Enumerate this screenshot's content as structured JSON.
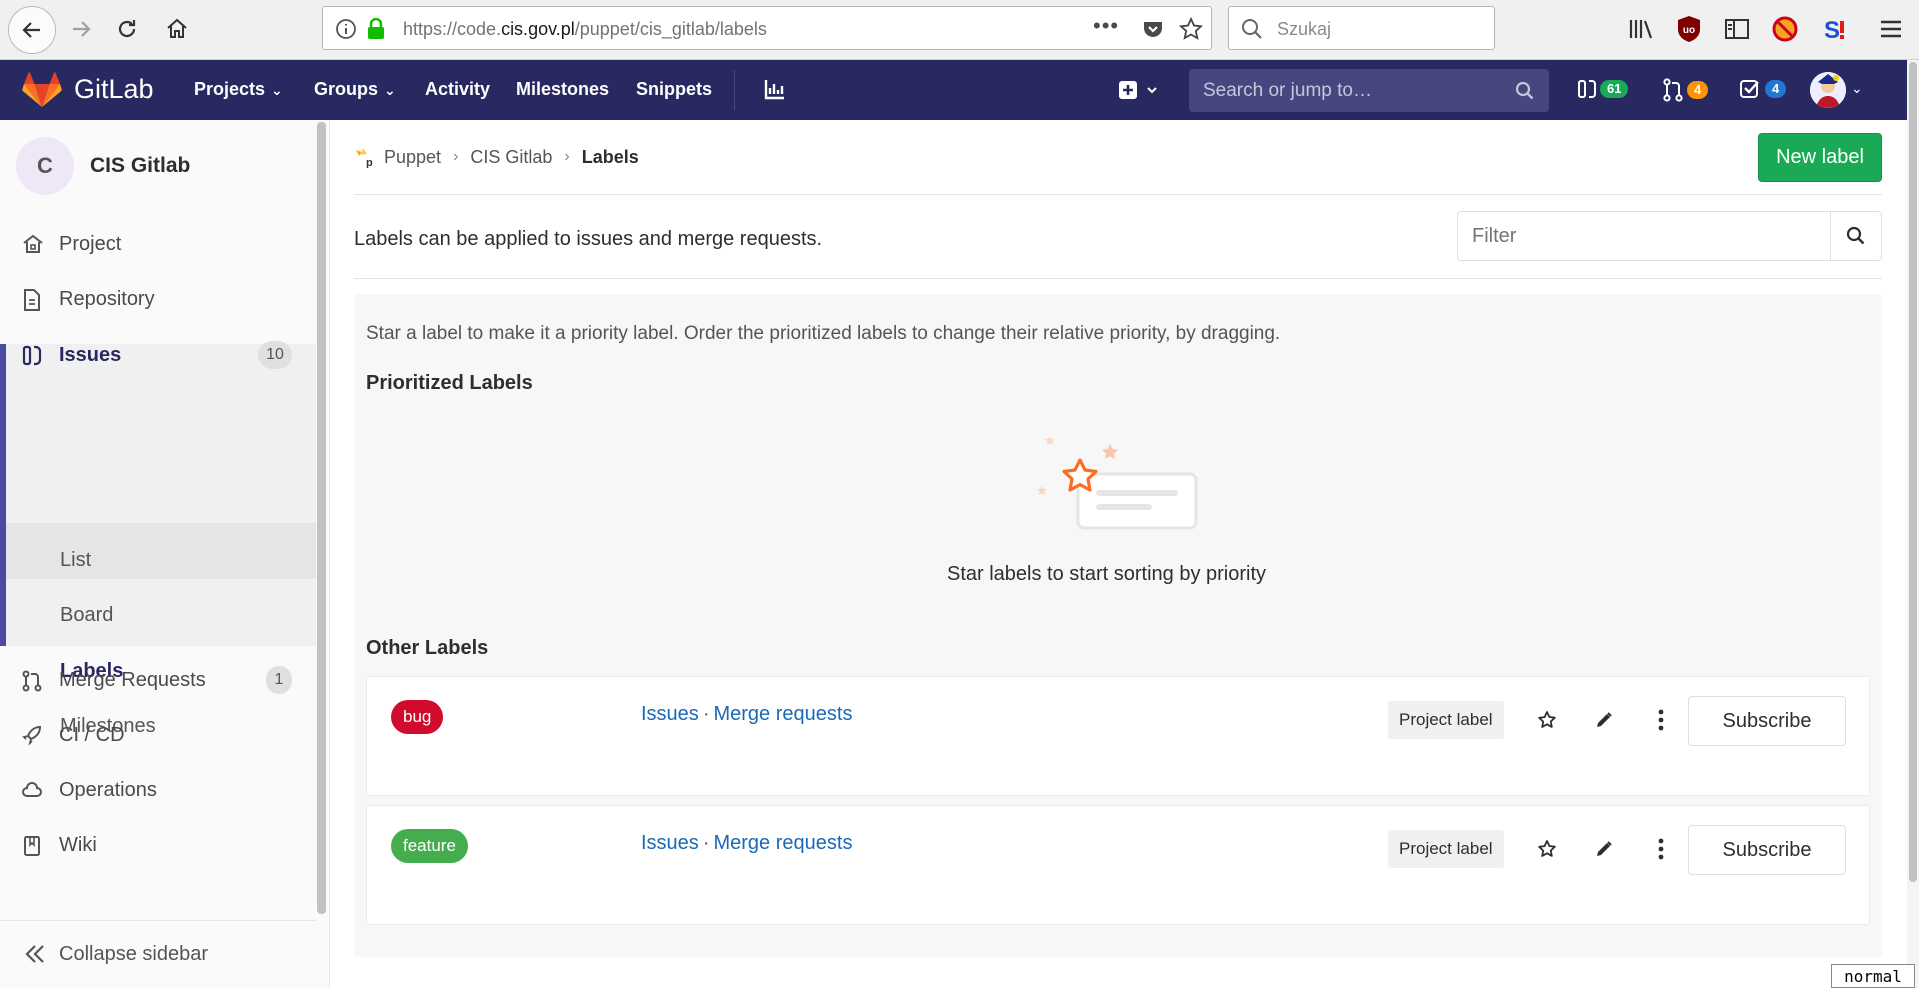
{
  "browser": {
    "url_prefix": "https://code.",
    "url_host": "cis.gov.pl",
    "url_path": "/puppet/cis_gitlab/labels",
    "search_placeholder": "Szukaj"
  },
  "header": {
    "brand": "GitLab",
    "nav": [
      {
        "label": "Projects"
      },
      {
        "label": "Groups"
      },
      {
        "label": "Activity"
      },
      {
        "label": "Milestones"
      },
      {
        "label": "Snippets"
      }
    ],
    "search_placeholder": "Search or jump to…",
    "issues_count": "61",
    "mr_count": "4",
    "todos_count": "4",
    "colors": {
      "bg": "#292961",
      "issues_badge": "#1aaa55",
      "mr_badge": "#fc9403",
      "todos_badge": "#1f78d1"
    }
  },
  "sidebar": {
    "project_initial": "C",
    "project_name": "CIS Gitlab",
    "items": [
      {
        "label": "Project"
      },
      {
        "label": "Repository"
      },
      {
        "label": "Issues",
        "count": "10"
      },
      {
        "label": "Merge Requests",
        "count": "1"
      },
      {
        "label": "CI / CD"
      },
      {
        "label": "Operations"
      },
      {
        "label": "Wiki"
      }
    ],
    "issues_sub": [
      {
        "label": "List"
      },
      {
        "label": "Board"
      },
      {
        "label": "Labels"
      },
      {
        "label": "Milestones"
      }
    ],
    "collapse_label": "Collapse sidebar"
  },
  "breadcrumb": {
    "items": [
      "Puppet",
      "CIS Gitlab",
      "Labels"
    ]
  },
  "main": {
    "new_label_button": "New label",
    "intro": "Labels can be applied to issues and merge requests.",
    "filter_placeholder": "Filter",
    "hint": "Star a label to make it a priority label. Order the prioritized labels to change their relative priority, by dragging.",
    "prioritized_heading": "Prioritized Labels",
    "empty_text": "Star labels to start sorting by priority",
    "other_heading": "Other Labels",
    "labels": [
      {
        "name": "bug",
        "color": "#d10b2b",
        "issues_link": "Issues",
        "mr_link": "Merge requests",
        "type": "Project label",
        "subscribe": "Subscribe"
      },
      {
        "name": "feature",
        "color": "#44ad4e",
        "issues_link": "Issues",
        "mr_link": "Merge requests",
        "type": "Project label",
        "subscribe": "Subscribe"
      }
    ]
  },
  "status_mode": "normal"
}
